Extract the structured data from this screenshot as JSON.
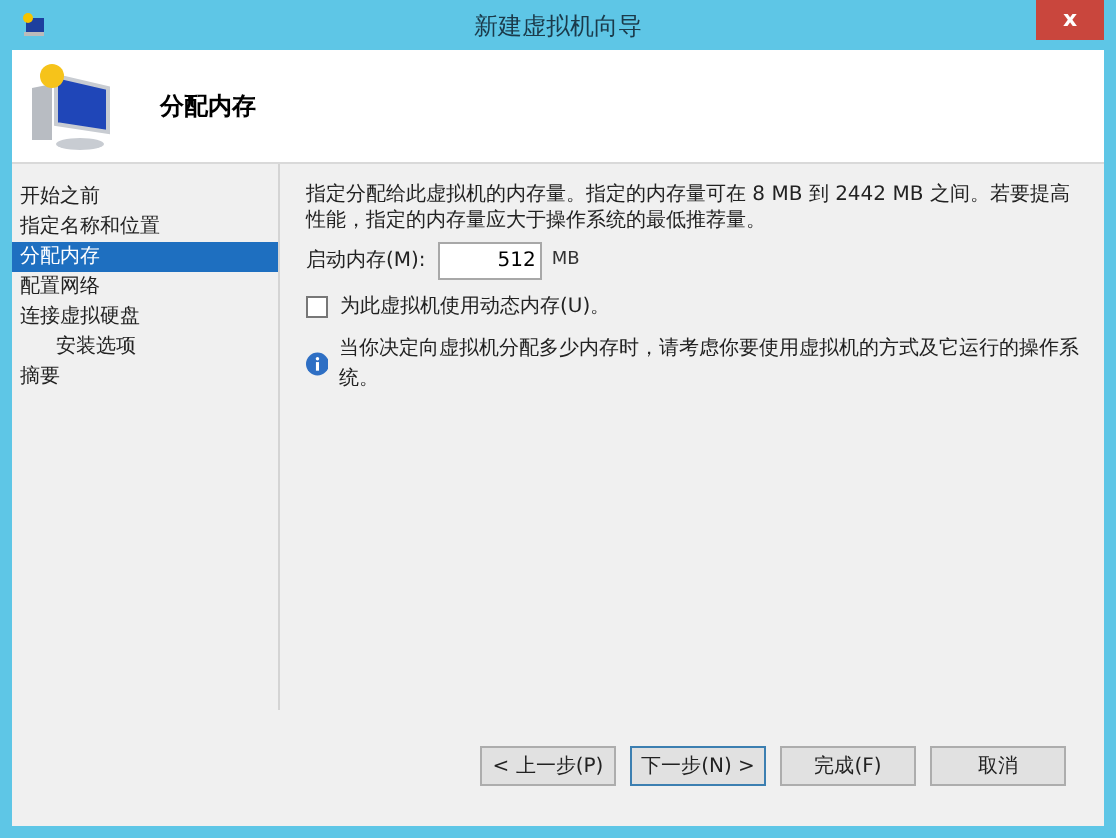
{
  "window": {
    "title": "新建虚拟机向导",
    "close": "x"
  },
  "header": {
    "title": "分配内存"
  },
  "nav": [
    {
      "label": "开始之前",
      "selected": false
    },
    {
      "label": "指定名称和位置",
      "selected": false
    },
    {
      "label": "分配内存",
      "selected": true
    },
    {
      "label": "配置网络",
      "selected": false
    },
    {
      "label": "连接虚拟硬盘",
      "selected": false,
      "children": [
        {
          "label": "安装选项",
          "selected": false
        }
      ]
    },
    {
      "label": "摘要",
      "selected": false
    }
  ],
  "content": {
    "description": "指定分配给此虚拟机的内存量。指定的内存量可在 8 MB 到 2442 MB 之间。若要提高性能，指定的内存量应大于操作系统的最低推荐量。",
    "startup_memory": {
      "label": "启动内存(M):",
      "value": "512",
      "unit": "MB"
    },
    "dynamic_memory": {
      "label": "为此虚拟机使用动态内存(U)。",
      "checked": false
    },
    "info": "当你决定向虚拟机分配多少内存时，请考虑你要使用虚拟机的方式及它运行的操作系统。"
  },
  "buttons": [
    {
      "label": "< 上一步(P)",
      "selected": false
    },
    {
      "label": "下一步(N) >",
      "selected": true
    },
    {
      "label": "完成(F)",
      "selected": false
    },
    {
      "label": "取消",
      "selected": false
    }
  ]
}
